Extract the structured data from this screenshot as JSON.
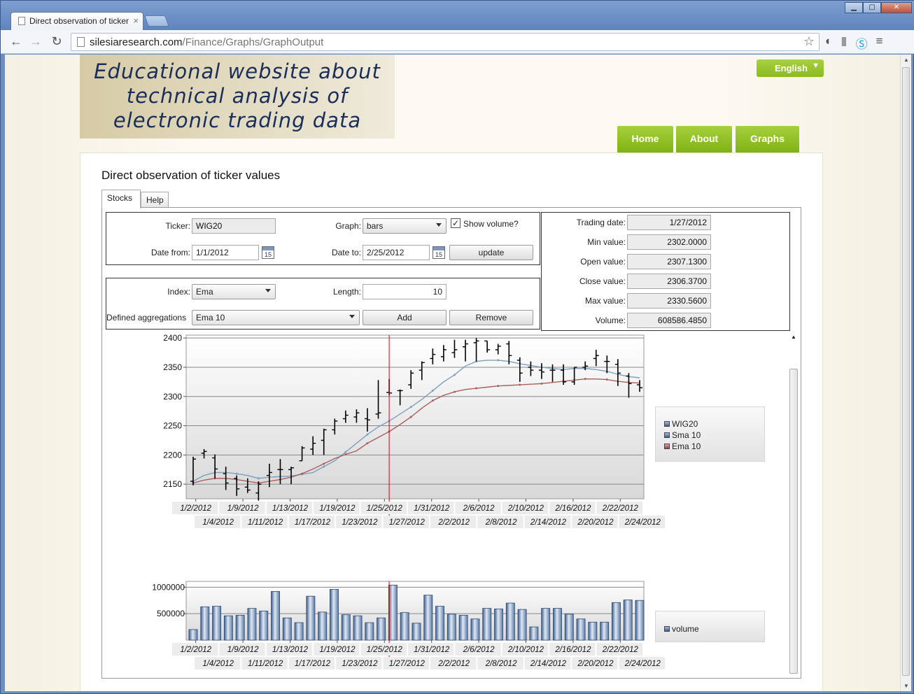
{
  "browser": {
    "tab_title": "Direct observation of ticker",
    "url_host": "silesiaresearch.com",
    "url_path": "/Finance/Graphs/GraphOutput"
  },
  "site": {
    "banner_lines": [
      "Educational website about",
      "technical analysis of",
      "electronic trading data"
    ],
    "language": "English",
    "menu": [
      "Home",
      "About",
      "Graphs"
    ]
  },
  "page": {
    "title": "Direct observation of ticker values",
    "tabs": [
      "Stocks",
      "Help"
    ]
  },
  "form": {
    "ticker_label": "Ticker:",
    "ticker_value": "WIG20",
    "graph_label": "Graph:",
    "graph_value": "bars",
    "show_volume_label": "Show volume?",
    "show_volume_checked": true,
    "date_from_label": "Date from:",
    "date_from_value": "1/1/2012",
    "date_to_label": "Date to:",
    "date_to_value": "2/25/2012",
    "calendar_day": "15",
    "update_label": "update",
    "index_label": "Index:",
    "index_value": "Ema",
    "length_label": "Length:",
    "length_value": "10",
    "aggregations_label": "Defined aggregations",
    "aggregations_value": "Ema 10",
    "add_label": "Add",
    "remove_label": "Remove"
  },
  "details": {
    "trading_date_label": "Trading date:",
    "trading_date": "1/27/2012",
    "min_label": "Min value:",
    "min": "2302.0000",
    "open_label": "Open value:",
    "open": "2307.1300",
    "close_label": "Close value:",
    "close": "2306.3700",
    "max_label": "Max value:",
    "max": "2330.5600",
    "volume_label": "Volume:",
    "volume": "608586.4850"
  },
  "chart_data": [
    {
      "type": "line",
      "y_ticks": [
        2150,
        2200,
        2250,
        2300,
        2350,
        2400
      ],
      "ylim": [
        2125,
        2405
      ],
      "grid": true,
      "legend": [
        "WIG20",
        "Sma 10",
        "Ema 10"
      ],
      "legend_placement": "right",
      "colors": {
        "sma": "#7f9fbf",
        "ema": "#a86060",
        "cursor": "#e00000"
      },
      "x_labels_top": [
        "1/2/2012",
        "1/9/2012",
        "1/13/2012",
        "1/19/2012",
        "1/25/2012",
        "1/31/2012",
        "2/6/2012",
        "2/10/2012",
        "2/16/2012",
        "2/22/2012"
      ],
      "x_labels_bottom": [
        "1/4/2012",
        "1/11/2012",
        "1/17/2012",
        "1/23/2012",
        "1/27/2012",
        "2/2/2012",
        "2/8/2012",
        "2/14/2012",
        "2/20/2012",
        "2/24/2012"
      ],
      "cursor_index": 18,
      "ohlc": [
        {
          "o": 2155,
          "h": 2197,
          "l": 2148,
          "c": 2193
        },
        {
          "o": 2203,
          "h": 2210,
          "l": 2194,
          "c": 2206
        },
        {
          "o": 2195,
          "h": 2201,
          "l": 2160,
          "c": 2176
        },
        {
          "o": 2168,
          "h": 2180,
          "l": 2140,
          "c": 2152
        },
        {
          "o": 2160,
          "h": 2165,
          "l": 2130,
          "c": 2142
        },
        {
          "o": 2145,
          "h": 2160,
          "l": 2135,
          "c": 2140
        },
        {
          "o": 2135,
          "h": 2155,
          "l": 2122,
          "c": 2150
        },
        {
          "o": 2165,
          "h": 2185,
          "l": 2145,
          "c": 2170
        },
        {
          "o": 2175,
          "h": 2193,
          "l": 2150,
          "c": 2175
        },
        {
          "o": 2175,
          "h": 2180,
          "l": 2150,
          "c": 2178
        },
        {
          "o": 2190,
          "h": 2215,
          "l": 2190,
          "c": 2212
        },
        {
          "o": 2210,
          "h": 2232,
          "l": 2200,
          "c": 2220
        },
        {
          "o": 2225,
          "h": 2245,
          "l": 2200,
          "c": 2243
        },
        {
          "o": 2243,
          "h": 2262,
          "l": 2235,
          "c": 2258
        },
        {
          "o": 2262,
          "h": 2276,
          "l": 2255,
          "c": 2268
        },
        {
          "o": 2265,
          "h": 2278,
          "l": 2255,
          "c": 2272
        },
        {
          "o": 2262,
          "h": 2280,
          "l": 2240,
          "c": 2260
        },
        {
          "o": 2270,
          "h": 2328,
          "l": 2262,
          "c": 2272
        },
        {
          "o": 2307,
          "h": 2330,
          "l": 2302,
          "c": 2306
        },
        {
          "o": 2310,
          "h": 2312,
          "l": 2285,
          "c": 2310
        },
        {
          "o": 2320,
          "h": 2345,
          "l": 2313,
          "c": 2340
        },
        {
          "o": 2345,
          "h": 2360,
          "l": 2328,
          "c": 2358
        },
        {
          "o": 2365,
          "h": 2382,
          "l": 2355,
          "c": 2372
        },
        {
          "o": 2368,
          "h": 2388,
          "l": 2360,
          "c": 2380
        },
        {
          "o": 2375,
          "h": 2397,
          "l": 2366,
          "c": 2380
        },
        {
          "o": 2385,
          "h": 2397,
          "l": 2360,
          "c": 2390
        },
        {
          "o": 2392,
          "h": 2400,
          "l": 2360,
          "c": 2395
        },
        {
          "o": 2395,
          "h": 2395,
          "l": 2375,
          "c": 2380
        },
        {
          "o": 2380,
          "h": 2390,
          "l": 2372,
          "c": 2386
        },
        {
          "o": 2390,
          "h": 2395,
          "l": 2355,
          "c": 2370
        },
        {
          "o": 2362,
          "h": 2367,
          "l": 2325,
          "c": 2340
        },
        {
          "o": 2350,
          "h": 2360,
          "l": 2335,
          "c": 2345
        },
        {
          "o": 2345,
          "h": 2357,
          "l": 2330,
          "c": 2342
        },
        {
          "o": 2345,
          "h": 2355,
          "l": 2325,
          "c": 2345
        },
        {
          "o": 2345,
          "h": 2355,
          "l": 2320,
          "c": 2325
        },
        {
          "o": 2325,
          "h": 2350,
          "l": 2320,
          "c": 2350
        },
        {
          "o": 2350,
          "h": 2360,
          "l": 2345,
          "c": 2352
        },
        {
          "o": 2365,
          "h": 2380,
          "l": 2352,
          "c": 2370
        },
        {
          "o": 2360,
          "h": 2370,
          "l": 2340,
          "c": 2360
        },
        {
          "o": 2355,
          "h": 2364,
          "l": 2318,
          "c": 2340
        },
        {
          "o": 2335,
          "h": 2340,
          "l": 2298,
          "c": 2322
        },
        {
          "o": 2320,
          "h": 2328,
          "l": 2308,
          "c": 2315
        }
      ],
      "sma": [
        2155,
        2165,
        2170,
        2170,
        2168,
        2165,
        2160,
        2162,
        2163,
        2164,
        2167,
        2170,
        2180,
        2190,
        2205,
        2220,
        2235,
        2248,
        2258,
        2270,
        2282,
        2295,
        2310,
        2325,
        2337,
        2352,
        2360,
        2362,
        2362,
        2360,
        2356,
        2353,
        2350,
        2348,
        2346,
        2348,
        2348,
        2346,
        2343,
        2338,
        2334,
        2332
      ],
      "ema": [
        2152,
        2157,
        2160,
        2160,
        2158,
        2155,
        2152,
        2155,
        2158,
        2162,
        2168,
        2176,
        2185,
        2194,
        2201,
        2207,
        2220,
        2230,
        2240,
        2252,
        2265,
        2280,
        2293,
        2302,
        2308,
        2312,
        2314,
        2316,
        2318,
        2319,
        2320,
        2321,
        2322,
        2324,
        2326,
        2328,
        2330,
        2330,
        2329,
        2326,
        2324,
        2323
      ]
    },
    {
      "type": "bar",
      "y_ticks": [
        500000,
        1000000
      ],
      "ylim": [
        0,
        1110000
      ],
      "legend": [
        "volume"
      ],
      "legend_placement": "right",
      "values": [
        200000,
        630000,
        640000,
        460000,
        470000,
        600000,
        550000,
        920000,
        420000,
        330000,
        830000,
        530000,
        960000,
        480000,
        460000,
        330000,
        420000,
        1040000,
        520000,
        320000,
        850000,
        640000,
        490000,
        470000,
        400000,
        600000,
        590000,
        700000,
        580000,
        250000,
        600000,
        600000,
        490000,
        400000,
        340000,
        340000,
        710000,
        760000,
        750000
      ]
    }
  ]
}
